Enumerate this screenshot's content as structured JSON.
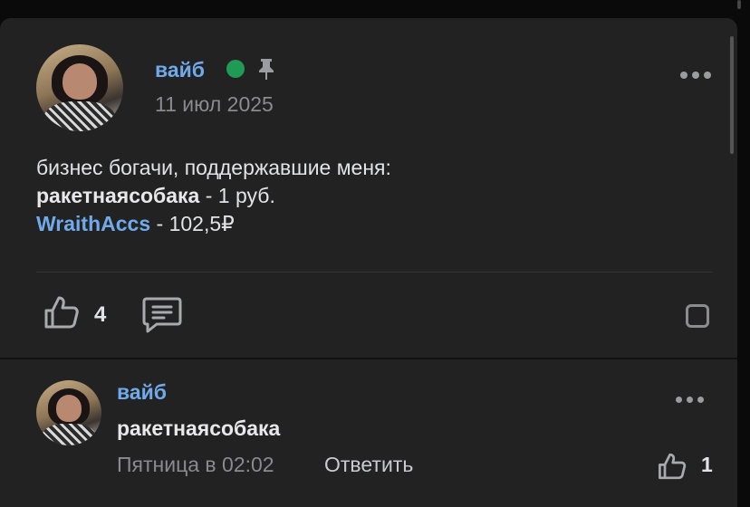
{
  "post": {
    "author": "вайб",
    "date": "11 июл 2025",
    "text_line1": "бизнес богачи, поддержавшие меня:",
    "supporter1_name": "ракетнаясобака",
    "supporter1_amount": " - 1 руб.",
    "supporter2_name": "WraithAccs",
    "supporter2_amount": " - 102,5₽",
    "likes": "4"
  },
  "comment": {
    "author": "вайб",
    "text": "ракетнаясобака",
    "date": "Пятница в 02:02",
    "reply_label": "Ответить",
    "likes": "1"
  },
  "colors": {
    "accent": "#71aaeb",
    "online": "#1f9b55",
    "background": "#222222"
  },
  "icons": {
    "pin": "pin-icon",
    "like": "thumbs-up-icon",
    "comment": "comment-icon",
    "bookmark": "bookmark-icon",
    "more": "more-icon"
  }
}
